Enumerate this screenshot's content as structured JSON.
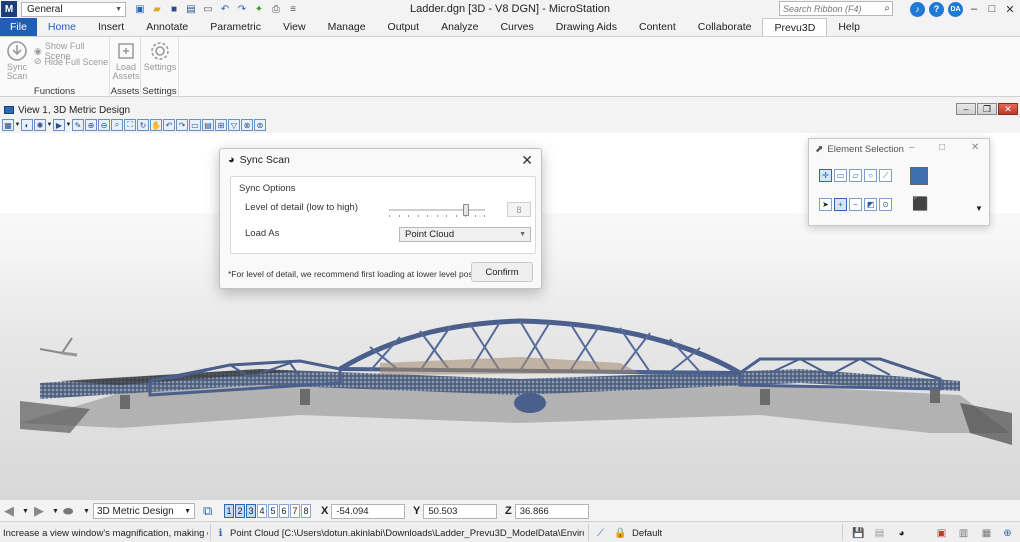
{
  "titlebar": {
    "workspace": "General",
    "title": "Ladder.dgn [3D - V8 DGN] - MicroStation",
    "search_placeholder": "Search Ribbon (F4)",
    "user_initials": "DA"
  },
  "tabs": [
    "File",
    "Home",
    "Insert",
    "Annotate",
    "Parametric",
    "View",
    "Manage",
    "Output",
    "Analyze",
    "Curves",
    "Drawing Aids",
    "Content",
    "Collaborate",
    "Prevu3D",
    "Help"
  ],
  "ribbon": {
    "functions": {
      "label": "Functions",
      "sync_scan": "Sync\nScan",
      "show_full_scene": "Show Full Scene",
      "hide_full_scene": "Hide Full Scene"
    },
    "assets": {
      "label": "Assets",
      "load_assets": "Load\nAssets"
    },
    "settings": {
      "label": "Settings",
      "settings_btn": "Settings"
    }
  },
  "view": {
    "title": "View 1, 3D Metric Design"
  },
  "sync_dialog": {
    "title": "Sync Scan",
    "group_label": "Sync Options",
    "lod_label": "Level of detail (low to high)",
    "lod_value": "8",
    "lod_fraction": 0.8,
    "load_as_label": "Load As",
    "load_as_value": "Point Cloud",
    "note": "*For level of detail, we recommend first loading at lower level possible",
    "confirm": "Confirm"
  },
  "element_selection": {
    "title": "Element Selection"
  },
  "bottom": {
    "view_name": "3D Metric Design",
    "views": [
      "1",
      "2",
      "3",
      "4",
      "5",
      "6",
      "7",
      "8"
    ],
    "x_label": "X",
    "x_value": "-54.094",
    "y_label": "Y",
    "y_value": "50.503",
    "z_label": "Z",
    "z_value": "36.866"
  },
  "status": {
    "message": "Increase a view window's magnification, making elemen",
    "path": "Point Cloud [C:\\Users\\dotun.akinlabi\\Downloads\\Ladder_Prevu3D_ModelData\\Environment_main.pc",
    "level": "Default"
  },
  "colors": {
    "accent": "#1f5fb8",
    "file_tab": "#1f5fb8",
    "help_icon": "#1f7ad6",
    "user_avatar": "#1f7ad6"
  }
}
